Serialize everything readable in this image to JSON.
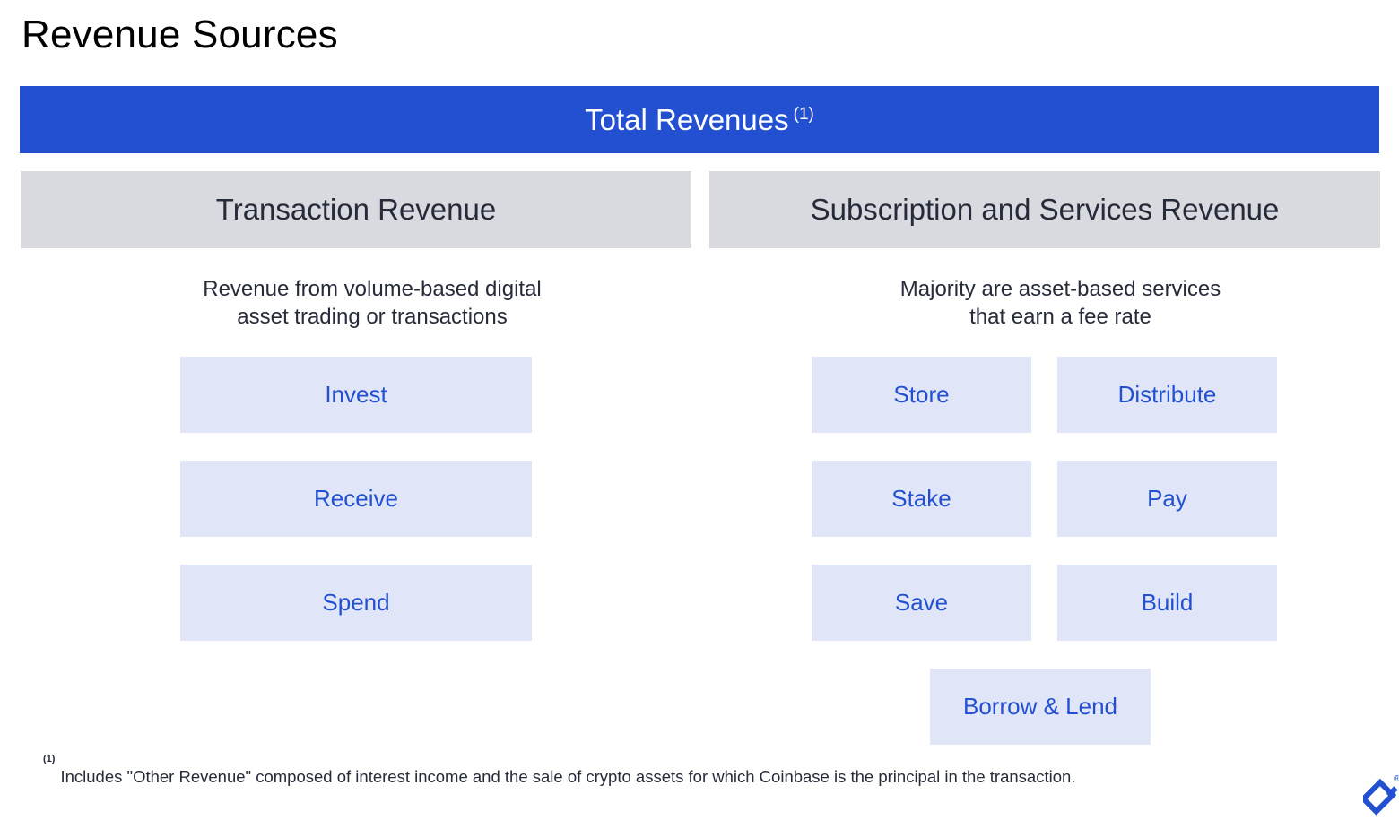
{
  "page": {
    "title": "Revenue Sources"
  },
  "total": {
    "label": "Total Revenues",
    "footnote_marker": "(1)",
    "color": "#2250d0"
  },
  "categories": [
    {
      "name": "Transaction Revenue",
      "description_line1": "Revenue from volume-based digital",
      "description_line2": "asset trading or transactions",
      "items": [
        "Invest",
        "Receive",
        "Spend"
      ]
    },
    {
      "name": "Subscription and Services Revenue",
      "description_line1": "Majority are asset-based services",
      "description_line2": "that earn a fee rate",
      "items": [
        "Store",
        "Distribute",
        "Stake",
        "Pay",
        "Save",
        "Build",
        "Borrow & Lend"
      ]
    }
  ],
  "footnote": {
    "marker": "(1)",
    "text": "Includes \"Other Revenue\" composed of interest income and the sale of crypto assets for which Coinbase is the principal in the transaction."
  },
  "logo": {
    "icon": "toptal-logo-icon",
    "registered": "®"
  },
  "colors": {
    "accent_blue": "#2250d0",
    "category_gray": "#d9dadf",
    "item_bg": "#e0e5f7",
    "text_dark": "#262b3a"
  }
}
